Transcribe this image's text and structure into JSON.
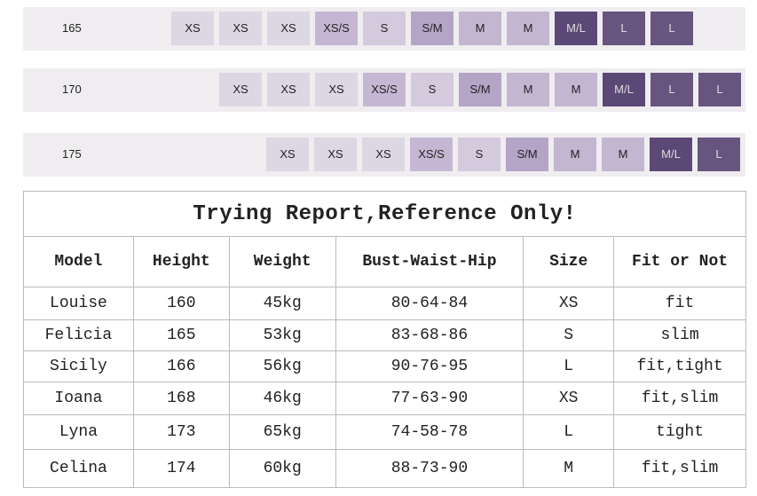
{
  "size_chart": {
    "rows": [
      {
        "height": "165",
        "sizes": [
          "XS",
          "XS",
          "XS",
          "XS/S",
          "S",
          "S/M",
          "M",
          "M",
          "M/L",
          "L",
          "L"
        ]
      },
      {
        "height": "170",
        "sizes": [
          "XS",
          "XS",
          "XS",
          "XS/S",
          "S",
          "S/M",
          "M",
          "M",
          "M/L",
          "L",
          "L"
        ]
      },
      {
        "height": "175",
        "sizes": [
          "XS",
          "XS",
          "XS",
          "XS/S",
          "S",
          "S/M",
          "M",
          "M",
          "M/L",
          "L"
        ]
      }
    ],
    "colors": {
      "XS": "#dcd7e3",
      "XS/S": "#c5b7d3",
      "S": "#d3cadd",
      "S/M": "#b4a5c7",
      "M": "#c2b6d1",
      "M/L": "#5c4876",
      "L": "#67547f"
    }
  },
  "report": {
    "title": "Trying Report,Reference Only!",
    "headers": [
      "Model",
      "Height",
      "Weight",
      "Bust-Waist-Hip",
      "Size",
      "Fit or Not"
    ],
    "rows": [
      [
        "Louise",
        "160",
        "45kg",
        "80-64-84",
        "XS",
        "fit"
      ],
      [
        "Felicia",
        "165",
        "53kg",
        "83-68-86",
        "S",
        "slim"
      ],
      [
        "Sicily",
        "166",
        "56kg",
        "90-76-95",
        "L",
        "fit,tight"
      ],
      [
        "Ioana",
        "168",
        "46kg",
        "77-63-90",
        "XS",
        "fit,slim"
      ],
      [
        "Lyna",
        "173",
        "65kg",
        "74-58-78",
        "L",
        "tight"
      ],
      [
        "Celina",
        "174",
        "60kg",
        "88-73-90",
        "M",
        "fit,slim"
      ]
    ]
  }
}
